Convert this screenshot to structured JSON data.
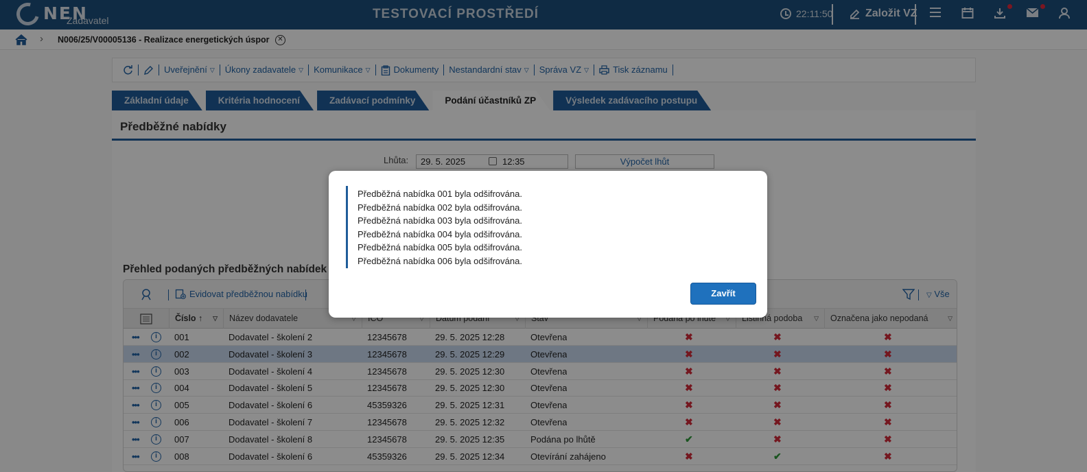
{
  "app": {
    "logo_text": "NEN",
    "logo_sub": "Zadavatel",
    "env_title": "TESTOVACÍ PROSTŘEDÍ",
    "clock": "22:11:50",
    "create_label": "Založit VZ"
  },
  "breadcrumb": {
    "text": "N006/25/V00005136 - Realizace energetických úspor"
  },
  "toolbar": {
    "items": [
      "Uveřejnění",
      "Úkony zadavatele",
      "Komunikace",
      "Dokumenty",
      "Nestandardní stav",
      "Správa VZ",
      "Tisk záznamu"
    ]
  },
  "tabs": [
    "Základní údaje",
    "Kritéria hodnocení",
    "Zadávací podmínky",
    "Podání účastníků ZP",
    "Výsledek zadávacího postupu"
  ],
  "section": {
    "title": "Předběžné nabídky",
    "lhuta_label": "Lhůta:",
    "lhuta_date": "29. 5. 2025",
    "lhuta_time": "12:35",
    "calc_label": "Výpočet lhůt"
  },
  "grid": {
    "title": "Přehled podaných předběžných nabídek",
    "add_label": "Evidovat předběžnou nabídku",
    "vse_label": "Vše",
    "headers": [
      "Číslo",
      "Název dodavatele",
      "IČO",
      "Datum podání",
      "Stav",
      "Podaná po lhůtě",
      "Listinná podoba",
      "Označena jako nepodaná"
    ],
    "rows": [
      {
        "num": "001",
        "name": "Dodavatel - školení 2",
        "ico": "12345678",
        "date": "29. 5. 2025 12:28",
        "stav": "Otevřena",
        "late": "x",
        "paper": "x",
        "nepod": "x"
      },
      {
        "num": "002",
        "name": "Dodavatel - školení 3",
        "ico": "12345678",
        "date": "29. 5. 2025 12:29",
        "stav": "Otevřena",
        "late": "x",
        "paper": "x",
        "nepod": "x"
      },
      {
        "num": "003",
        "name": "Dodavatel - školení 4",
        "ico": "12345678",
        "date": "29. 5. 2025 12:30",
        "stav": "Otevřena",
        "late": "x",
        "paper": "x",
        "nepod": "x"
      },
      {
        "num": "004",
        "name": "Dodavatel - školení 5",
        "ico": "12345678",
        "date": "29. 5. 2025 12:30",
        "stav": "Otevřena",
        "late": "x",
        "paper": "x",
        "nepod": "x"
      },
      {
        "num": "005",
        "name": "Dodavatel - školení 6",
        "ico": "45359326",
        "date": "29. 5. 2025 12:31",
        "stav": "Otevřena",
        "late": "x",
        "paper": "x",
        "nepod": "x"
      },
      {
        "num": "006",
        "name": "Dodavatel - školení 7",
        "ico": "12345678",
        "date": "29. 5. 2025 12:32",
        "stav": "Otevřena",
        "late": "x",
        "paper": "x",
        "nepod": "x"
      },
      {
        "num": "007",
        "name": "Dodavatel - školení 8",
        "ico": "12345678",
        "date": "29. 5. 2025 12:35",
        "stav": "Podána po lhůtě",
        "late": "ok",
        "paper": "x",
        "nepod": "x"
      },
      {
        "num": "008",
        "name": "Dodavatel - školení 6",
        "ico": "45359326",
        "date": "29. 5. 2025 12:34",
        "stav": "Otevírání zahájeno",
        "late": "x",
        "paper": "ok",
        "nepod": "x"
      }
    ]
  },
  "modal": {
    "messages": [
      "Předběžná nabídka 001 byla odšifrována.",
      "Předběžná nabídka 002 byla odšifrována.",
      "Předběžná nabídka 003 byla odšifrována.",
      "Předběžná nabídka 004 byla odšifrována.",
      "Předběžná nabídka 005 byla odšifrována.",
      "Předběžná nabídka 006 byla odšifrována."
    ],
    "close_label": "Zavřít"
  },
  "colors": {
    "brand": "#1d4f7c",
    "accent": "#1f71bd",
    "error": "#d42a3a",
    "ok": "#2e9a3a"
  }
}
